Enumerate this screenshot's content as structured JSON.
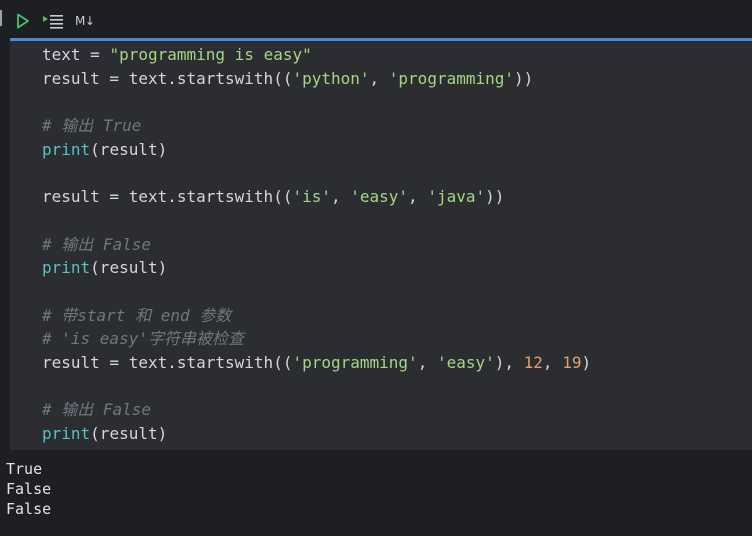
{
  "toolbar": {
    "run_icon": "play-icon",
    "run_all_icon": "run-below-icon",
    "markdown_label": "M↓",
    "accent_color": "#4a88da"
  },
  "code": {
    "lines": [
      {
        "tokens": [
          {
            "t": "text = "
          },
          {
            "t": "\"programming is easy\"",
            "k": "str"
          }
        ]
      },
      {
        "tokens": [
          {
            "t": "result = text.startswith(("
          },
          {
            "t": "'python'",
            "k": "str"
          },
          {
            "t": ", "
          },
          {
            "t": "'programming'",
            "k": "str"
          },
          {
            "t": "))"
          }
        ]
      },
      {
        "tokens": []
      },
      {
        "tokens": [
          {
            "t": "# 输出 True",
            "k": "cmt"
          }
        ]
      },
      {
        "tokens": [
          {
            "t": "print",
            "k": "fn"
          },
          {
            "t": "(result)"
          }
        ]
      },
      {
        "tokens": []
      },
      {
        "tokens": [
          {
            "t": "result = text.startswith(("
          },
          {
            "t": "'is'",
            "k": "str"
          },
          {
            "t": ", "
          },
          {
            "t": "'easy'",
            "k": "str"
          },
          {
            "t": ", "
          },
          {
            "t": "'java'",
            "k": "str"
          },
          {
            "t": "))"
          }
        ]
      },
      {
        "tokens": []
      },
      {
        "tokens": [
          {
            "t": "# 输出 False",
            "k": "cmt"
          }
        ]
      },
      {
        "tokens": [
          {
            "t": "print",
            "k": "fn"
          },
          {
            "t": "(result)"
          }
        ]
      },
      {
        "tokens": []
      },
      {
        "tokens": [
          {
            "t": "# 带start 和 end 参数",
            "k": "cmt"
          }
        ]
      },
      {
        "tokens": [
          {
            "t": "# 'is easy'字符串被检查",
            "k": "cmt"
          }
        ]
      },
      {
        "tokens": [
          {
            "t": "result = text.startswith(("
          },
          {
            "t": "'programming'",
            "k": "str"
          },
          {
            "t": ", "
          },
          {
            "t": "'easy'",
            "k": "str"
          },
          {
            "t": "), "
          },
          {
            "t": "12",
            "k": "num"
          },
          {
            "t": ", "
          },
          {
            "t": "19",
            "k": "num"
          },
          {
            "t": ")"
          }
        ]
      },
      {
        "tokens": []
      },
      {
        "tokens": [
          {
            "t": "# 输出 False",
            "k": "cmt"
          }
        ]
      },
      {
        "tokens": [
          {
            "t": "print",
            "k": "fn"
          },
          {
            "t": "(result)"
          }
        ]
      }
    ]
  },
  "output": {
    "lines": [
      "True",
      "False",
      "False"
    ]
  }
}
